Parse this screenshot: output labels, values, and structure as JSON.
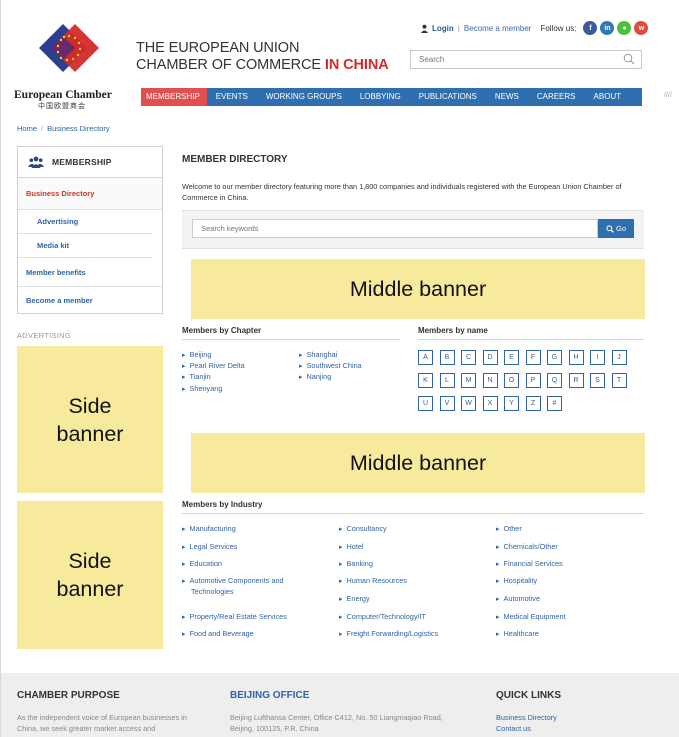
{
  "header": {
    "brand_line1": "THE EUROPEAN UNION",
    "brand_line2": "CHAMBER OF COMMERCE ",
    "brand_line2_red": "IN CHINA",
    "org_name": "European Chamber",
    "org_name_cn": "中国欧盟商会",
    "login_label": "Login",
    "become_member_label": "Become a member",
    "follow_label": "Follow us:",
    "social_icons": [
      "facebook-icon",
      "linkedin-icon",
      "wechat-icon",
      "weibo-icon"
    ],
    "search_placeholder": "Search"
  },
  "nav": {
    "items": [
      "MEMBERSHIP",
      "EVENTS",
      "WORKING GROUPS",
      "LOBBYING",
      "PUBLICATIONS",
      "NEWS",
      "CAREERS",
      "ABOUT"
    ],
    "active": "MEMBERSHIP",
    "tail": "////"
  },
  "breadcrumb": [
    "Home",
    "Business Directory"
  ],
  "sidebar": {
    "heading": "MEMBERSHIP",
    "active_item": "Business Directory",
    "sub_items": [
      "Advertising",
      "Media kit"
    ],
    "items": [
      "Member benefits",
      "Become a member"
    ]
  },
  "advertising_label": "ADVERTISING",
  "banners": {
    "side_line1": "Side",
    "side_line2": "banner",
    "middle": "Middle banner"
  },
  "main": {
    "title": "MEMBER DIRECTORY",
    "intro": "Welcome to our member directory featuring more than 1,800 companies and individuals registered with the European Union Chamber of Commerce in China.",
    "keyword_placeholder": "Search keywords",
    "go_label": "Go"
  },
  "by_chapter": {
    "title": "Members by Chapter",
    "col1": [
      "Beijing",
      "Pearl River Delta",
      "Tianjin",
      "Shenyang"
    ],
    "col2": [
      "Shanghai",
      "Southwest China",
      "Nanjing"
    ]
  },
  "by_name": {
    "title": "Members by name",
    "letters": [
      "A",
      "B",
      "C",
      "D",
      "E",
      "F",
      "G",
      "H",
      "I",
      "J",
      "K",
      "L",
      "M",
      "N",
      "O",
      "P",
      "Q",
      "R",
      "S",
      "T",
      "U",
      "V",
      "W",
      "X",
      "Y",
      "Z",
      "#"
    ]
  },
  "by_industry": {
    "title": "Members by Industry",
    "col1": [
      "Manufacturing",
      "Legal Services",
      "Education",
      "Automotive Components and",
      "Property/Real Estate Services",
      "Food and Beverage"
    ],
    "col1_wrap": "Technologies",
    "col2": [
      "Consultancy",
      "Hotel",
      "Banking",
      "Human Resources",
      "Energy",
      "Computer/Technology/IT",
      "Freight Forwarding/Logistics"
    ],
    "col3": [
      "Other",
      "Chemicals/Other",
      "Financial Services",
      "Hospitality",
      "Automotive",
      "Medical Equipment",
      "Healthcare"
    ]
  },
  "footer": {
    "purpose_title": "CHAMBER PURPOSE",
    "purpose_text1": "As the independent voice of European businesses in",
    "purpose_text2": "China, we seek greater market access and",
    "office_title": "BEIJING OFFICE",
    "office_text1": "Beijing Lufthansa Center, Office C412, No. 50 Liangmaqiao Road,",
    "office_text2": "Beijing, 100125, P.R. China",
    "links_title": "QUICK LINKS",
    "links": [
      "Business Directory",
      "Contact us"
    ]
  },
  "colors": {
    "nav_blue": "#2f6fb0",
    "nav_active_red": "#e05050",
    "brand_red": "#d12b2b",
    "link_blue": "#2e64a5",
    "banner_yellow": "#f8ea9d",
    "footer_title_dark": "#333333",
    "footer_title_blue": "#2e64a5"
  }
}
